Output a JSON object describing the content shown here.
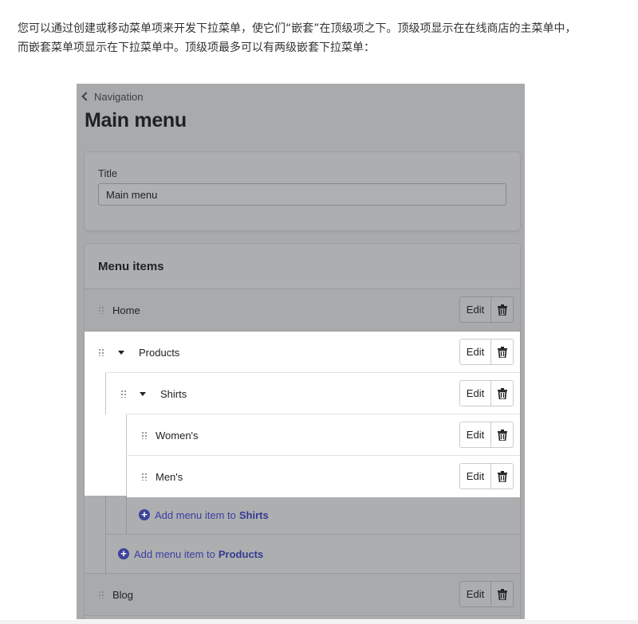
{
  "intro": {
    "line1": "您可以通过创建或移动菜单项来开发下拉菜单，使它们“嵌套”在顶级项之下。顶级项显示在在线商店的主菜单中，",
    "line2": "而嵌套菜单项显示在下拉菜单中。顶级项最多可以有两级嵌套下拉菜单："
  },
  "nav": {
    "back_label": "Navigation"
  },
  "page_title": "Main menu",
  "title_card": {
    "label": "Title",
    "value": "Main menu"
  },
  "menu_card": {
    "header": "Menu items",
    "edit_label": "Edit",
    "items": [
      {
        "label": "Home"
      },
      {
        "label": "Products"
      },
      {
        "label": "Shirts"
      },
      {
        "label": "Women's"
      },
      {
        "label": "Men's"
      },
      {
        "label": "Blog"
      }
    ],
    "add_prefix": "Add menu item to",
    "add_shirts_target": "Shirts",
    "add_products_target": "Products"
  },
  "icons": {
    "back": "chevron-left-icon",
    "drag": "drag-handle-icon",
    "expand": "caret-down-icon",
    "delete": "trash-icon",
    "add": "plus-circle-icon"
  },
  "colors": {
    "overlay": "#a9aaac",
    "accent": "#3d4399",
    "text": "#202223"
  }
}
